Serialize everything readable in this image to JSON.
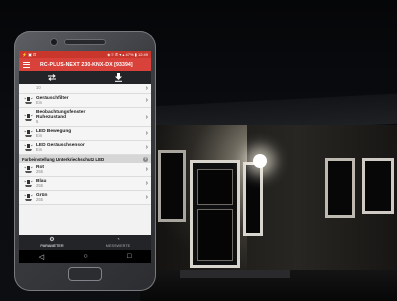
{
  "status_bar": {
    "left": "⚡ ▣ ⊡",
    "right": "◈ ≡ ✆ ▾ ▴ 47% ▮ 12:49"
  },
  "app_bar": {
    "title": "RC-PLUS-NEXT 230-KNX-DX [93394]"
  },
  "toolbar": {
    "left_icon": "swap-arrows-icon",
    "right_icon": "download-icon"
  },
  "list_items": [
    {
      "label": "",
      "value": "10"
    },
    {
      "label": "Geräuschfilter",
      "value": "Ein"
    },
    {
      "label": "Beobachtungsfenster Ruhezustand",
      "value": "5"
    },
    {
      "label": "LED Bewegung",
      "value": "Ein"
    },
    {
      "label": "LED Geräuschsensor",
      "value": "Ein"
    }
  ],
  "section": {
    "title": "Farbeinstellung Unterkriechschutz LED",
    "help": "?"
  },
  "section_items": [
    {
      "label": "Rot",
      "value": "255"
    },
    {
      "label": "Blau",
      "value": "255"
    },
    {
      "label": "Grün",
      "value": "255"
    }
  ],
  "bottom_nav": {
    "tabs": [
      {
        "label": "PARAMETER",
        "icon": "sliders-icon"
      },
      {
        "label": "MESSWERTE",
        "icon": "gauge-icon"
      }
    ]
  },
  "system_nav": {
    "back": "◁",
    "home": "○",
    "recents": "□"
  },
  "colors": {
    "app_bar": "#d9423a",
    "toolbar": "#222428",
    "section": "#d6d6d6"
  }
}
